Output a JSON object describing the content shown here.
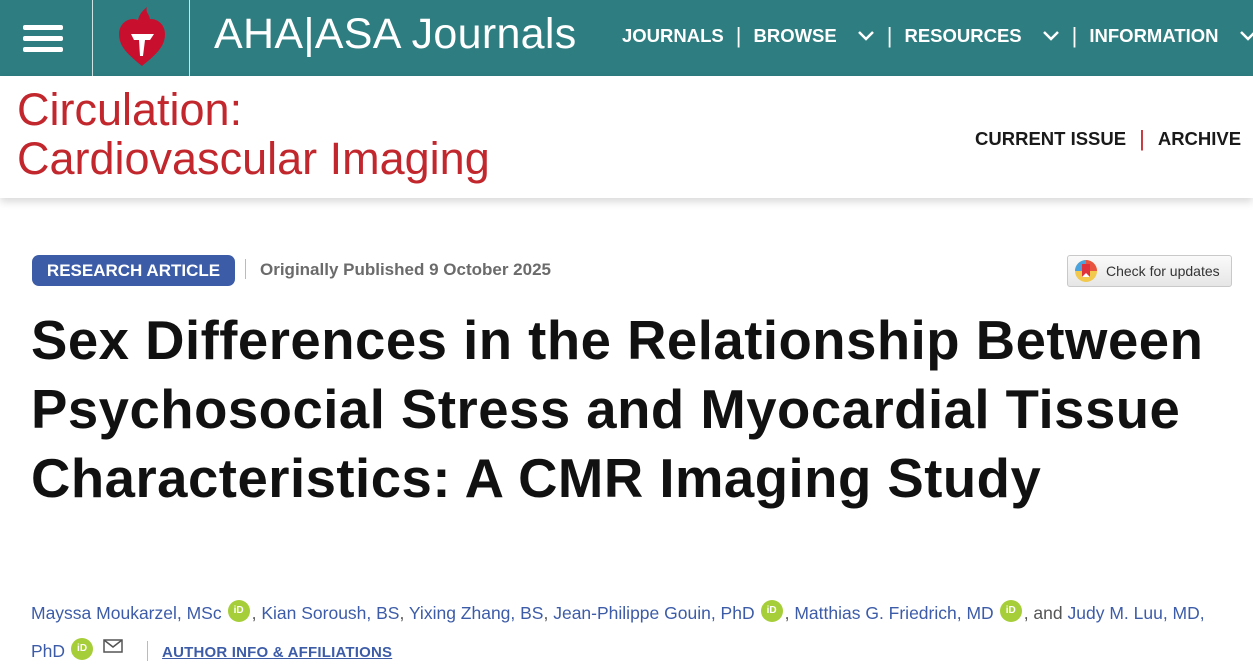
{
  "topbar": {
    "brand": "AHA|ASA Journals",
    "nav": [
      {
        "label": "JOURNALS",
        "has_dropdown": false
      },
      {
        "label": "BROWSE",
        "has_dropdown": true
      },
      {
        "label": "RESOURCES",
        "has_dropdown": true
      },
      {
        "label": "INFORMATION",
        "has_dropdown": true
      }
    ],
    "icons": [
      "menu-icon",
      "aha-heart-logo",
      "chevron-down-icon"
    ]
  },
  "journal": {
    "title_line1": "Circulation:",
    "title_line2": "Cardiovascular Imaging",
    "nav": [
      "CURRENT ISSUE",
      "ARCHIVE"
    ]
  },
  "article": {
    "type_badge": "RESEARCH ARTICLE",
    "published": "Originally Published 9 October 2025",
    "check_updates": "Check for updates",
    "title": "Sex Differences in the Relationship Between Psychosocial Stress and Myocardial Tissue Characteristics: A CMR Imaging Study",
    "authors": [
      {
        "name": "Mayssa Moukarzel, MSc",
        "orcid": true
      },
      {
        "name": "Kian Soroush, BS",
        "orcid": false
      },
      {
        "name": "Yixing Zhang, BS",
        "orcid": false
      },
      {
        "name": "Jean-Philippe Gouin, PhD",
        "orcid": true
      },
      {
        "name": "Matthias G. Friedrich, MD",
        "orcid": true
      },
      {
        "name": "Judy M. Luu, MD, PhD",
        "orcid": true,
        "corresponding": true
      }
    ],
    "and_text": ", and",
    "orcid_label": "iD",
    "affiliations_link": "AUTHOR INFO & AFFILIATIONS"
  },
  "colors": {
    "topbar_bg": "#2e7d80",
    "journal_red": "#c1272d",
    "badge_blue": "#3d5ca8",
    "orcid_green": "#a6ce39"
  }
}
